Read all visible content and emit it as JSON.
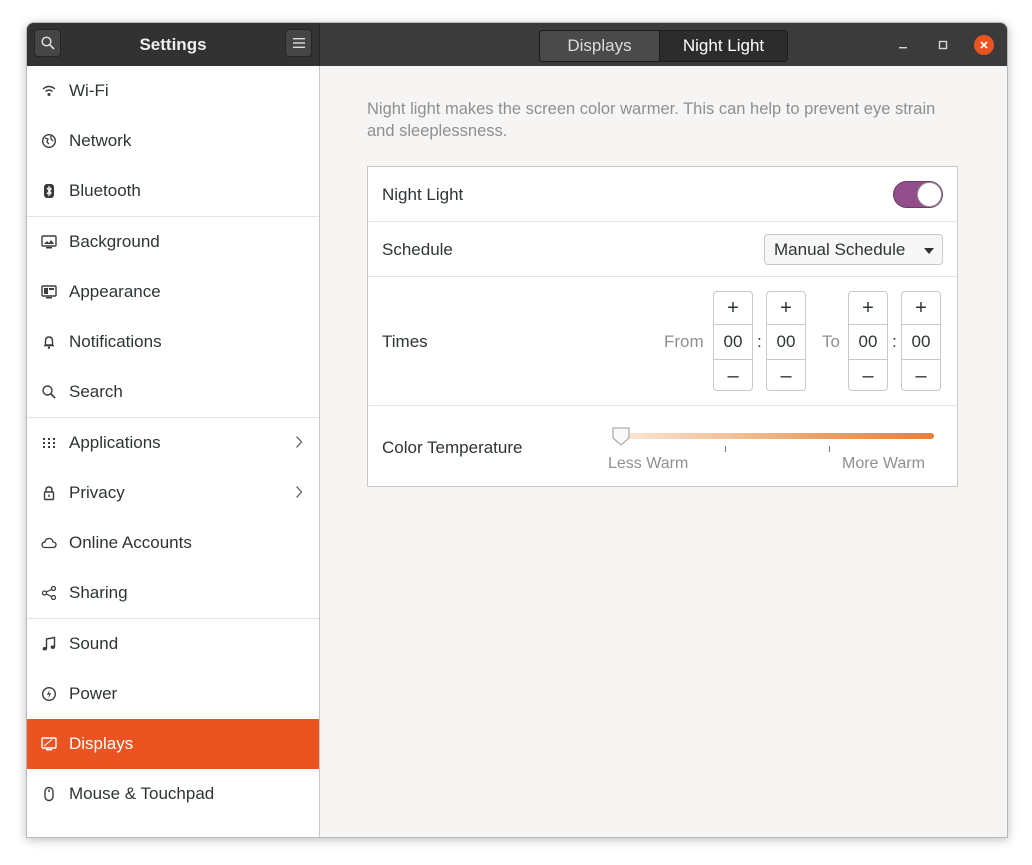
{
  "header": {
    "app_title": "Settings",
    "tabs": [
      {
        "label": "Displays",
        "active": false
      },
      {
        "label": "Night Light",
        "active": true
      }
    ]
  },
  "sidebar": {
    "items": [
      {
        "label": "Wi-Fi",
        "icon": "wifi-icon"
      },
      {
        "label": "Network",
        "icon": "network-icon"
      },
      {
        "label": "Bluetooth",
        "icon": "bluetooth-icon"
      },
      {
        "label": "Background",
        "icon": "background-icon"
      },
      {
        "label": "Appearance",
        "icon": "appearance-icon"
      },
      {
        "label": "Notifications",
        "icon": "bell-icon"
      },
      {
        "label": "Search",
        "icon": "search-icon"
      },
      {
        "label": "Applications",
        "icon": "apps-grid-icon",
        "has_submenu": true
      },
      {
        "label": "Privacy",
        "icon": "lock-icon",
        "has_submenu": true
      },
      {
        "label": "Online Accounts",
        "icon": "cloud-icon"
      },
      {
        "label": "Sharing",
        "icon": "share-icon"
      },
      {
        "label": "Sound",
        "icon": "music-note-icon"
      },
      {
        "label": "Power",
        "icon": "power-icon"
      },
      {
        "label": "Displays",
        "icon": "display-icon",
        "selected": true
      },
      {
        "label": "Mouse & Touchpad",
        "icon": "mouse-icon"
      }
    ]
  },
  "main": {
    "description": "Night light makes the screen color warmer. This can help to prevent eye strain and sleeplessness.",
    "night_light": {
      "label": "Night Light",
      "enabled": true
    },
    "schedule": {
      "label": "Schedule",
      "value": "Manual Schedule"
    },
    "times": {
      "label": "Times",
      "from_label": "From",
      "to_label": "To",
      "separator": ":",
      "increment": "+",
      "decrement": "–",
      "from_hours": "00",
      "from_minutes": "00",
      "to_hours": "00",
      "to_minutes": "00"
    },
    "color_temperature": {
      "label": "Color Temperature",
      "min_label": "Less Warm",
      "max_label": "More Warm",
      "level": 0.0
    }
  },
  "colors": {
    "accent": "#e95420",
    "toggle_on": "#924d8b",
    "titlebar": "#3b3b3b"
  }
}
